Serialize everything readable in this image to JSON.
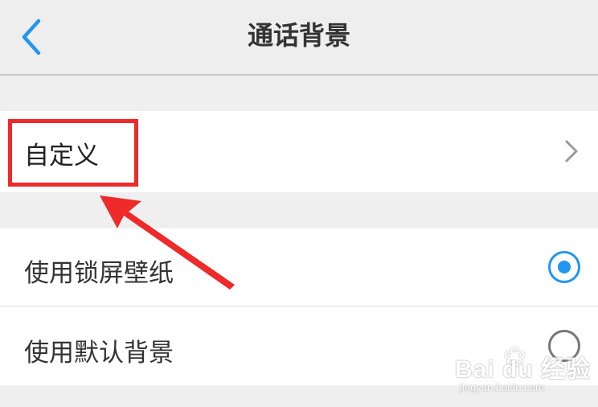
{
  "header": {
    "title": "通话背景",
    "back_icon": "chevron-left-icon"
  },
  "rows": {
    "custom": {
      "label": "自定义",
      "icon": "chevron-right-icon"
    },
    "lock_wallpaper": {
      "label": "使用锁屏壁纸",
      "selected": true
    },
    "default_background": {
      "label": "使用默认背景",
      "selected": false
    }
  },
  "annotation": {
    "box_color": "#ee2a2a",
    "arrow_color": "#ee2a2a"
  },
  "watermark": {
    "logo": "Bai du 经验",
    "url": "jingyan.baidu.com"
  },
  "colors": {
    "accent": "#2196f3",
    "background": "#efefef",
    "row": "#ffffff"
  }
}
